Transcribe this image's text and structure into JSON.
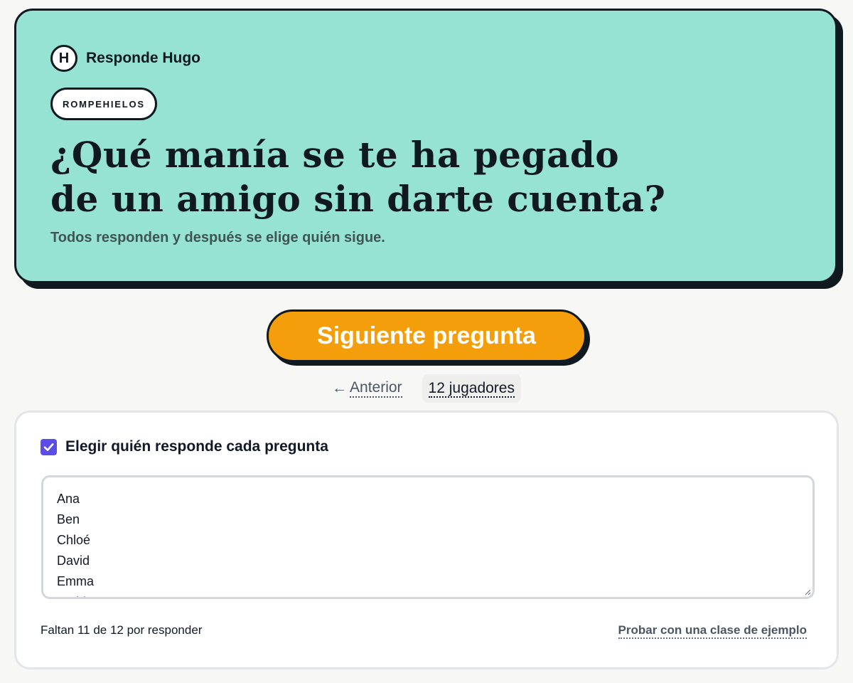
{
  "hero": {
    "brand_initial": "H",
    "brand_name": "Responde Hugo",
    "tag": "ROMPEHIELOS",
    "question_line1": "¿Qué manía se te ha pegado",
    "question_line2": "de un amigo sin darte cuenta?",
    "subtitle": "Todos responden y después se elige quién sigue.",
    "background_color": "#96e2d3"
  },
  "actions": {
    "next_label": "Siguiente pregunta",
    "next_color": "#f59e0b",
    "prev_arrow": "←",
    "prev_label": "Anterior",
    "players_label": "12 jugadores"
  },
  "players_panel": {
    "choose_label": "Elegir quién responde cada pregunta",
    "choose_checked": true,
    "checkbox_color": "#5b4ee8",
    "players": [
      "Ana",
      "Ben",
      "Chloé",
      "David",
      "Emma",
      "Farid"
    ],
    "remaining_text": "Faltan 11 de 12 por responder",
    "example_link": "Probar con una clase de ejemplo"
  }
}
